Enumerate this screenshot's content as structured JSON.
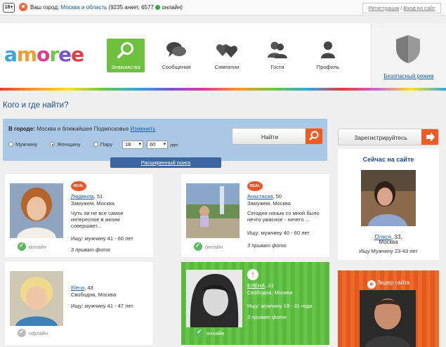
{
  "topbar": {
    "age_badge": "18+",
    "city_label": "Ваш город:",
    "city_link": "Москва и область",
    "stats": "(9235 анкет, 6577",
    "online_label": "онлайн)",
    "register": "Регистрация",
    "separator": " / ",
    "login": "Вход на сайт"
  },
  "header": {
    "logo": "amoree",
    "nav": [
      {
        "label": "Знакомства",
        "icon": "search-icon",
        "active": true
      },
      {
        "label": "Сообщения",
        "icon": "chat-bubbles-icon"
      },
      {
        "label": "Симпатии",
        "icon": "hearts-icon"
      },
      {
        "label": "Гости",
        "icon": "users-icon"
      },
      {
        "label": "Профиль",
        "icon": "user-icon"
      }
    ],
    "safe_mode": "Безопасный режим"
  },
  "section_title": "Кого и где найти?",
  "search": {
    "city_label": "В городе:",
    "city_value": "Москва и ближайшее Подмосковье",
    "change_link": "Изменить",
    "find_button": "Найти",
    "genders": [
      "Мужчину",
      "Женщину",
      "Пару"
    ],
    "gender_selected": "Женщину",
    "age_from": "18",
    "age_dash": "—",
    "age_to": "60",
    "age_unit": "лет",
    "advanced": "Расширенный поиск"
  },
  "cards": [
    {
      "name": "Людмила",
      "age": ", 51",
      "status_line": "Замужем, Москва",
      "desc": "Чуть ли не все самое интересное в жизни совершает...",
      "seeking": "Ищу: мужчину 41 - 60 лет",
      "private": "3 приват фото",
      "online": "онлайн",
      "badge": "REAL"
    },
    {
      "name": "Анастасия",
      "age": ", 50",
      "status_line": "Замужем, Москва",
      "desc": "Сегодня ночью со мной было нечто ужасное - ничего ...",
      "seeking": "Ищу: мужчину 40 - 60 лет",
      "private": "3 приват фото",
      "online": "онлайн",
      "badge": "REAL"
    },
    {
      "name": "Elena",
      "age": ", 43",
      "status_line": "Свободна, Москва",
      "seeking": "Ищу: мужчину 41 - 47 лет",
      "online": "офлайн"
    },
    {
      "name": "ЕЛЕНА",
      "age": ", 21",
      "status_line": "Свободна, Москва",
      "seeking": "Ищу: мужчину 18 - 31 года",
      "private": "3 приват фото",
      "online": "онлайн"
    }
  ],
  "sidebar": {
    "register_button": "Зарегистрируйтесь",
    "online_title": "Сейчас на сайте",
    "online_name": "Олеся",
    "online_age": ", 33,",
    "online_city": "Москва",
    "online_seeking": "Ищу Мужчину 23-43 лет",
    "leader_title": "Лидер сайта"
  },
  "colors": {
    "accent_green": "#6fc03f",
    "accent_orange": "#f05a23",
    "link_blue": "#1a5fa8",
    "search_bg": "#a9c8e6"
  }
}
